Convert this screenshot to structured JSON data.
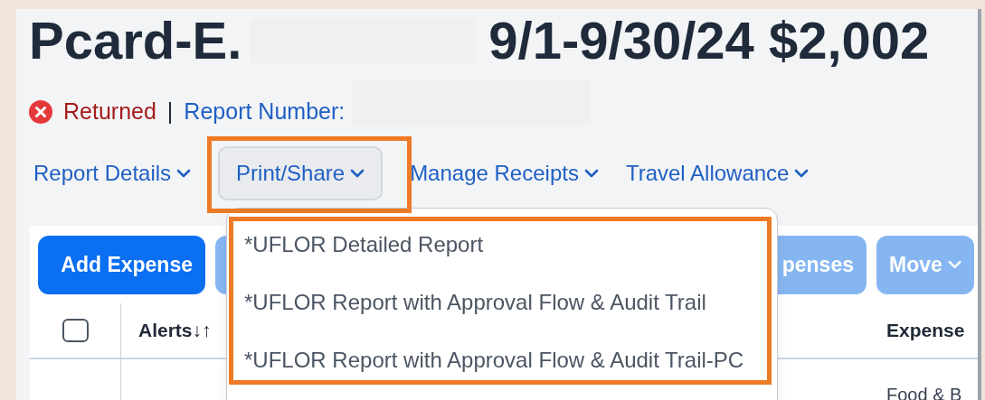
{
  "title": {
    "prefix": "Pcard-E.",
    "suffix": "9/1-9/30/24 $2,002"
  },
  "status": {
    "label": "Returned",
    "separator": "|",
    "report_number_label": "Report Number:"
  },
  "nav": [
    {
      "label": "Report Details",
      "selected": false
    },
    {
      "label": "Print/Share",
      "selected": true
    },
    {
      "label": "Manage Receipts",
      "selected": false
    },
    {
      "label": "Travel Allowance",
      "selected": false
    }
  ],
  "dropdown": {
    "items": [
      "*UFLOR Detailed Report",
      "*UFLOR Report with Approval Flow & Audit Trail",
      "*UFLOR Report with Approval Flow & Audit Trail-PC"
    ]
  },
  "toolbar": {
    "buttons": [
      {
        "kind": "primary",
        "label": "Add Expense",
        "disabled": false
      },
      {
        "kind": "plain",
        "disabled": true
      },
      {
        "kind": "plain",
        "label": "penses",
        "disabled": true
      },
      {
        "kind": "menu",
        "label": "Move",
        "disabled": true
      }
    ]
  },
  "table": {
    "columns": [
      {
        "kind": "checkbox",
        "checked": false
      },
      {
        "kind": "sortable",
        "label": "Alerts",
        "sort_icon": "↓↑"
      },
      {
        "kind": "text",
        "label": "Expense"
      }
    ],
    "rows": [
      {
        "expense": "Food & B"
      }
    ]
  }
}
